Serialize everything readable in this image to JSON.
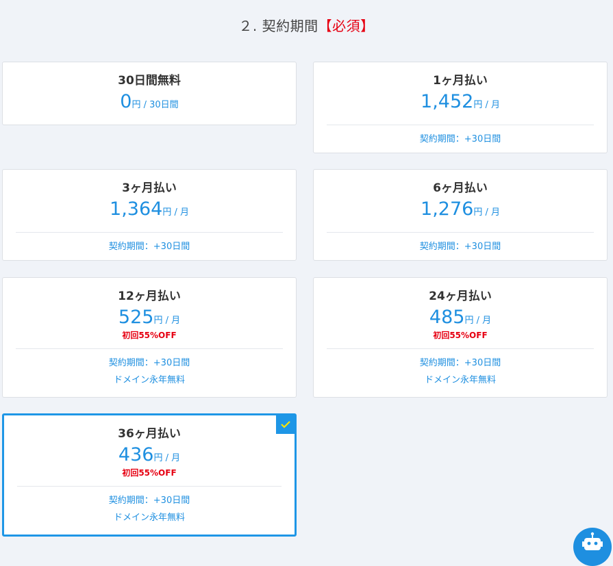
{
  "section": {
    "title": "２. 契約期間",
    "required": "【必須】"
  },
  "plans": [
    {
      "name": "30日間無料",
      "amount": "0",
      "unit": "円",
      "per": " / 30日間"
    },
    {
      "name": "1ヶ月払い",
      "amount": "1,452",
      "unit": "円",
      "per": " / 月",
      "info1": "契約期間：+30日間"
    },
    {
      "name": "3ヶ月払い",
      "amount": "1,364",
      "unit": "円",
      "per": " / 月",
      "info1": "契約期間：+30日間"
    },
    {
      "name": "6ヶ月払い",
      "amount": "1,276",
      "unit": "円",
      "per": " / 月",
      "info1": "契約期間：+30日間"
    },
    {
      "name": "12ヶ月払い",
      "amount": "525",
      "unit": "円",
      "per": " / 月",
      "discount": "初回55%OFF",
      "info1": "契約期間：+30日間",
      "info2": "ドメイン永年無料"
    },
    {
      "name": "24ヶ月払い",
      "amount": "485",
      "unit": "円",
      "per": " / 月",
      "discount": "初回55%OFF",
      "info1": "契約期間：+30日間",
      "info2": "ドメイン永年無料"
    },
    {
      "name": "36ヶ月払い",
      "amount": "436",
      "unit": "円",
      "per": " / 月",
      "discount": "初回55%OFF",
      "info1": "契約期間：+30日間",
      "info2": "ドメイン永年無料",
      "selected": true
    }
  ],
  "icons": {
    "check": "check-icon",
    "bot": "robot-icon"
  },
  "colors": {
    "accent": "#1e8fe0",
    "required": "#e60012",
    "background": "#f0f3f8"
  }
}
